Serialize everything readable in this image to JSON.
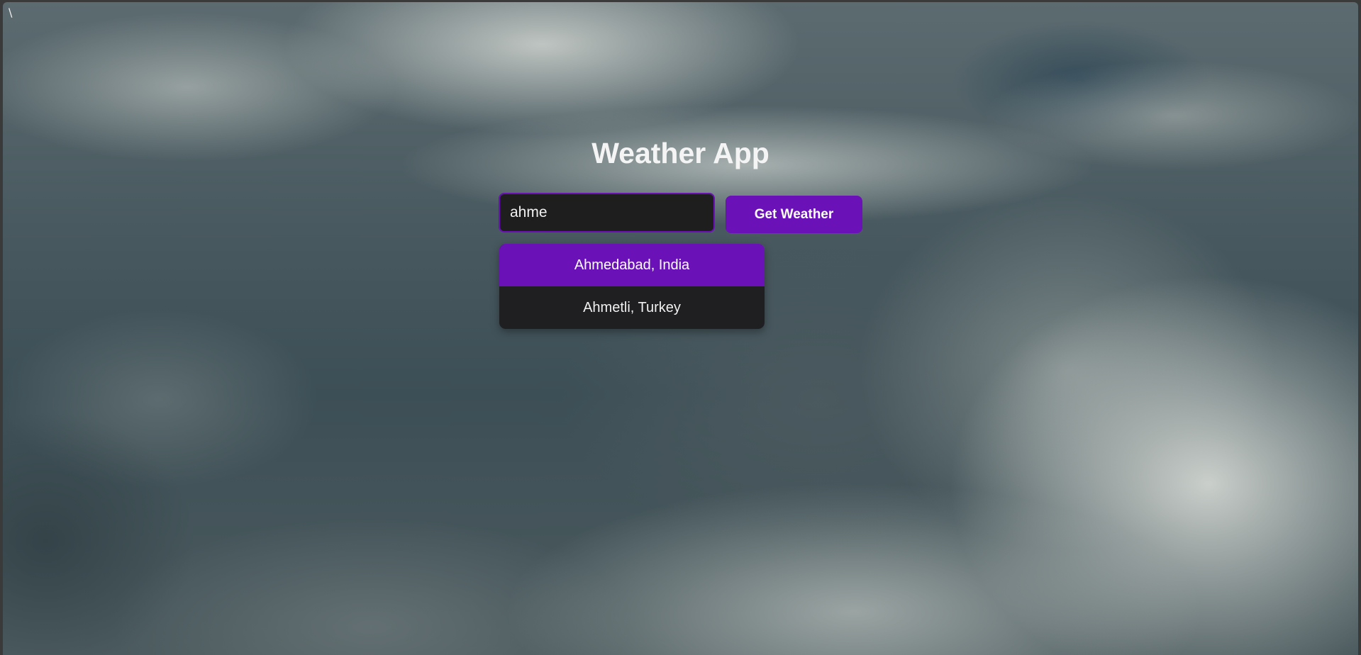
{
  "corner_mark": "\\",
  "app": {
    "title": "Weather App"
  },
  "search": {
    "value": "ahme",
    "button_label": "Get Weather"
  },
  "suggestions": [
    {
      "label": "Ahmedabad, India",
      "highlighted": true
    },
    {
      "label": "Ahmetli, Turkey",
      "highlighted": false
    }
  ],
  "colors": {
    "accent": "#6b11b8",
    "input_bg": "#1e1e1f",
    "text": "#f4f4f4"
  }
}
